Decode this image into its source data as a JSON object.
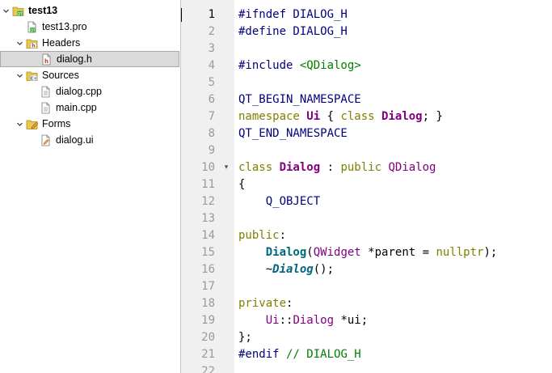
{
  "tree": {
    "items": [
      {
        "label": "test13",
        "level": 0,
        "type": "project",
        "expanded": true,
        "bold": true,
        "icon": "qt-project-icon"
      },
      {
        "label": "test13.pro",
        "level": 1,
        "type": "file",
        "icon": "qt-pro-file-icon"
      },
      {
        "label": "Headers",
        "level": 1,
        "type": "folder",
        "expanded": true,
        "icon": "headers-folder-icon"
      },
      {
        "label": "dialog.h",
        "level": 2,
        "type": "file",
        "selected": true,
        "icon": "header-file-icon"
      },
      {
        "label": "Sources",
        "level": 1,
        "type": "folder",
        "expanded": true,
        "icon": "sources-folder-icon"
      },
      {
        "label": "dialog.cpp",
        "level": 2,
        "type": "file",
        "icon": "source-file-icon"
      },
      {
        "label": "main.cpp",
        "level": 2,
        "type": "file",
        "icon": "source-file-icon"
      },
      {
        "label": "Forms",
        "level": 1,
        "type": "folder",
        "expanded": true,
        "icon": "forms-folder-icon"
      },
      {
        "label": "dialog.ui",
        "level": 2,
        "type": "file",
        "icon": "ui-file-icon"
      }
    ]
  },
  "editor": {
    "current_line": 1,
    "fold_marker_line": 10,
    "lines": [
      [
        [
          "pre",
          "#ifndef DIALOG_H"
        ]
      ],
      [
        [
          "pre",
          "#define DIALOG_H"
        ]
      ],
      [],
      [
        [
          "pre",
          "#include "
        ],
        [
          "str",
          "<QDialog>"
        ]
      ],
      [],
      [
        [
          "mac",
          "QT_BEGIN_NAMESPACE"
        ]
      ],
      [
        [
          "kw",
          "namespace "
        ],
        [
          "type",
          "Ui"
        ],
        [
          "punct",
          " { "
        ],
        [
          "kw",
          "class "
        ],
        [
          "type",
          "Dialog"
        ],
        [
          "punct",
          "; }"
        ]
      ],
      [
        [
          "mac",
          "QT_END_NAMESPACE"
        ]
      ],
      [],
      [
        [
          "kw",
          "class "
        ],
        [
          "type",
          "Dialog"
        ],
        [
          "punct",
          " : "
        ],
        [
          "kw",
          "public "
        ],
        [
          "uitype",
          "QDialog"
        ]
      ],
      [
        [
          "punct",
          "{"
        ]
      ],
      [
        [
          "punct",
          "    "
        ],
        [
          "mac",
          "Q_OBJECT"
        ]
      ],
      [],
      [
        [
          "kw",
          "public"
        ],
        [
          "punct",
          ":"
        ]
      ],
      [
        [
          "punct",
          "    "
        ],
        [
          "fn",
          "Dialog"
        ],
        [
          "punct",
          "("
        ],
        [
          "uitype",
          "QWidget"
        ],
        [
          "punct",
          " *parent = "
        ],
        [
          "kw",
          "nullptr"
        ],
        [
          "punct",
          ");"
        ]
      ],
      [
        [
          "punct",
          "    ~"
        ],
        [
          "dtor",
          "Dialog"
        ],
        [
          "punct",
          "();"
        ]
      ],
      [],
      [
        [
          "kw",
          "private"
        ],
        [
          "punct",
          ":"
        ]
      ],
      [
        [
          "punct",
          "    "
        ],
        [
          "uitype",
          "Ui"
        ],
        [
          "punct",
          "::"
        ],
        [
          "uitype",
          "Dialog"
        ],
        [
          "punct",
          " *ui;"
        ]
      ],
      [
        [
          "punct",
          "};"
        ]
      ],
      [
        [
          "pre",
          "#endif "
        ],
        [
          "cmt",
          "// DIALOG_H"
        ]
      ],
      []
    ]
  },
  "colors": {
    "preprocessor": "#000080",
    "keyword": "#808000",
    "type": "#800080",
    "string": "#008000",
    "function": "#00677c",
    "gutter_bg": "#f0f0f0",
    "selection_bg": "#dadada"
  }
}
